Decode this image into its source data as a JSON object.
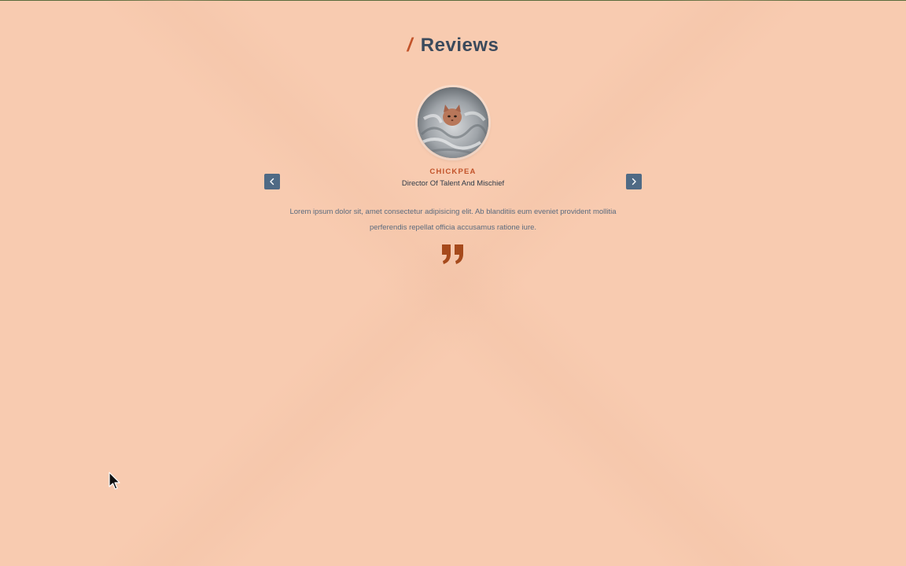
{
  "section": {
    "title": "Reviews"
  },
  "review": {
    "name": "CHICKPEA",
    "job": "Director Of Talent And Mischief",
    "text": "Lorem ipsum dolor sit, amet consectetur adipisicing elit. Ab blanditiis eum eveniet provident mollitia perferendis repellat officia accusamus ratione iure."
  },
  "icons": {
    "prev": "chevron-left-icon",
    "next": "chevron-right-icon",
    "quote": "quote-icon",
    "cursor": "mouse-cursor-icon"
  },
  "colors": {
    "background": "#f8cbb0",
    "accent": "#c2532a",
    "title": "#3b4a5c",
    "nav_button": "#4f6a85",
    "body_text": "#5b6b7e",
    "quote": "#a64a1c"
  }
}
